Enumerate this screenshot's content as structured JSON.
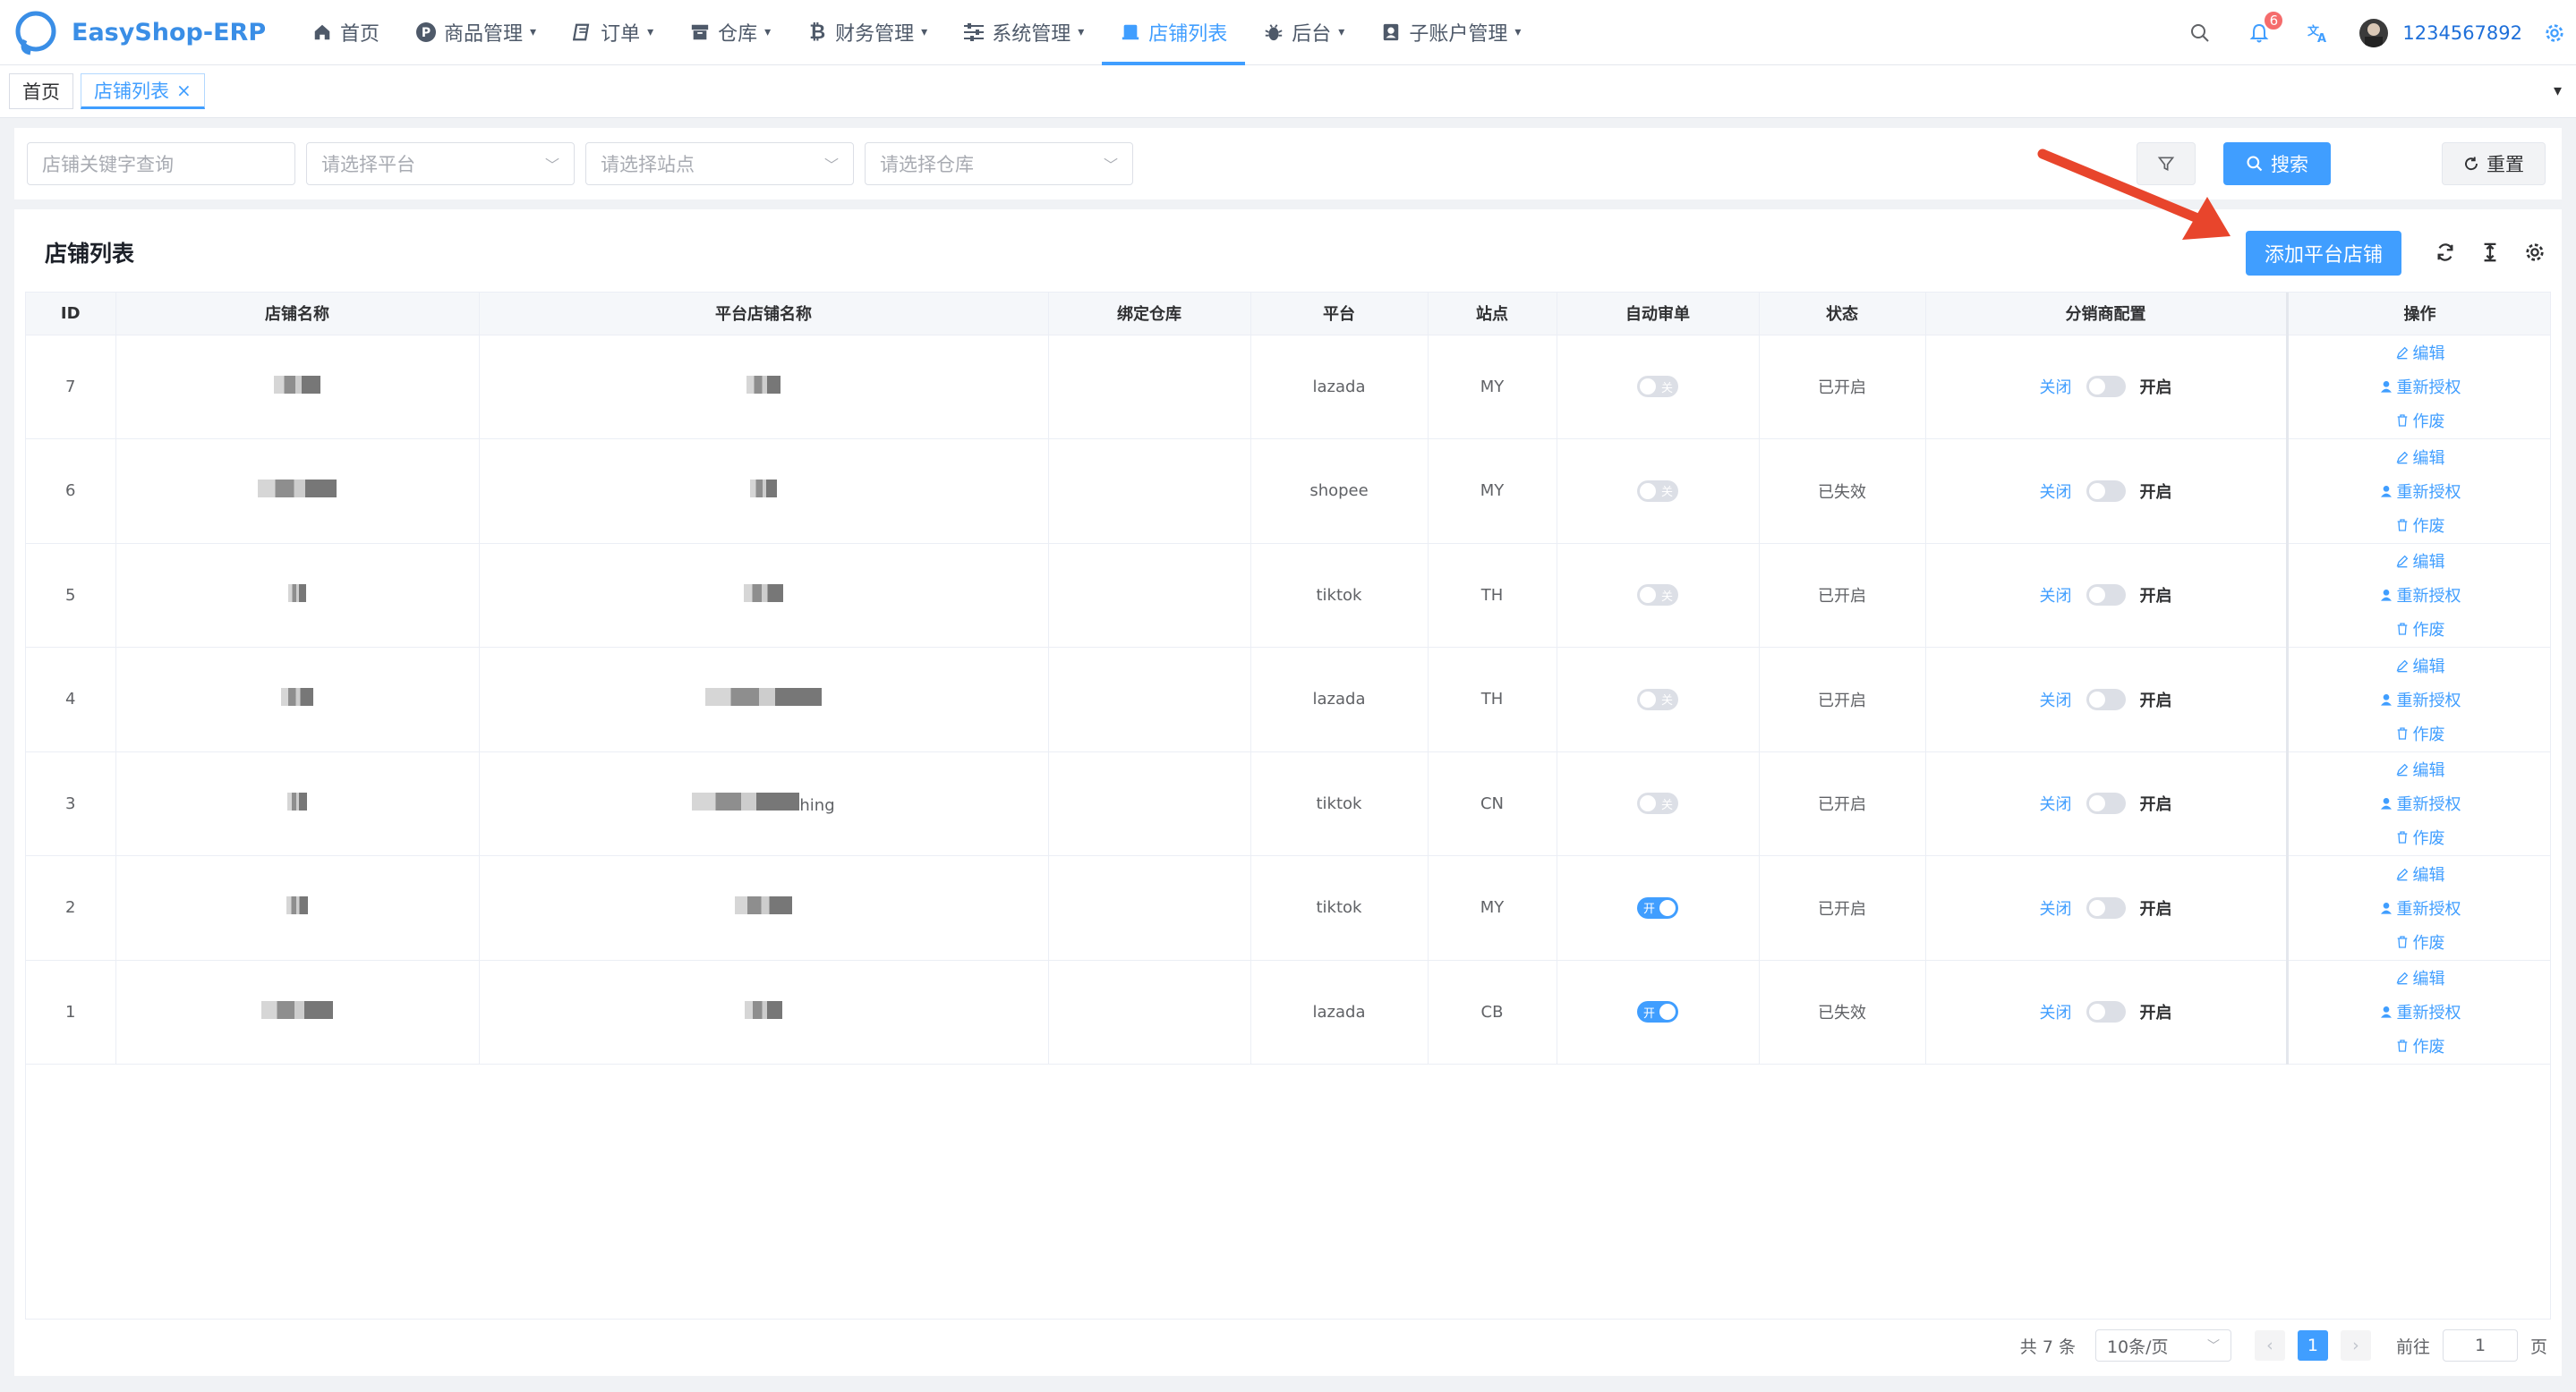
{
  "app": {
    "title": "EasyShop-ERP"
  },
  "nav": {
    "items": [
      {
        "label": "首页",
        "icon": "home-icon"
      },
      {
        "label": "商品管理",
        "icon": "product-icon"
      },
      {
        "label": "订单",
        "icon": "order-icon"
      },
      {
        "label": "仓库",
        "icon": "warehouse-icon"
      },
      {
        "label": "财务管理",
        "icon": "bitcoin-icon"
      },
      {
        "label": "系统管理",
        "icon": "sliders-icon"
      },
      {
        "label": "店铺列表",
        "icon": "store-icon",
        "active": true
      },
      {
        "label": "后台",
        "icon": "bug-icon"
      },
      {
        "label": "子账户管理",
        "icon": "user-card-icon"
      }
    ],
    "notification_count": "6",
    "username": "1234567892"
  },
  "tabs": [
    {
      "label": "首页"
    },
    {
      "label": "店铺列表",
      "active": true,
      "close": "×"
    }
  ],
  "filters": {
    "keyword_placeholder": "店铺关键字查询",
    "platform_placeholder": "请选择平台",
    "site_placeholder": "请选择站点",
    "warehouse_placeholder": "请选择仓库",
    "search_label": "搜索",
    "reset_label": "重置"
  },
  "main": {
    "title": "店铺列表",
    "add_button": "添加平台店铺"
  },
  "table": {
    "headers": [
      "ID",
      "店铺名称",
      "平台店铺名称",
      "绑定仓库",
      "平台",
      "站点",
      "自动审单",
      "状态",
      "分销商配置",
      "操作"
    ],
    "rows": [
      {
        "id": "7",
        "platform": "lazada",
        "site": "MY",
        "auto_review": "关",
        "auto_on": false,
        "status": "已开启"
      },
      {
        "id": "6",
        "platform": "shopee",
        "site": "MY",
        "auto_review": "关",
        "auto_on": false,
        "status": "已失效"
      },
      {
        "id": "5",
        "platform": "tiktok",
        "site": "TH",
        "auto_review": "关",
        "auto_on": false,
        "status": "已开启"
      },
      {
        "id": "4",
        "platform": "lazada",
        "site": "TH",
        "auto_review": "关",
        "auto_on": false,
        "status": "已开启"
      },
      {
        "id": "3",
        "platform": "tiktok",
        "site": "CN",
        "auto_review": "关",
        "auto_on": false,
        "status": "已开启",
        "platform_shop_text": "hing"
      },
      {
        "id": "2",
        "platform": "tiktok",
        "site": "MY",
        "auto_review": "开",
        "auto_on": true,
        "status": "已开启"
      },
      {
        "id": "1",
        "platform": "lazada",
        "site": "CB",
        "auto_review": "开",
        "auto_on": true,
        "status": "已失效"
      }
    ],
    "dist_off": "关闭",
    "dist_on": "开启",
    "op_edit": "编辑",
    "op_reauth": "重新授权",
    "op_void": "作废"
  },
  "pagination": {
    "total": "共 7 条",
    "page_size": "10条/页",
    "current": "1",
    "goto_label": "前往",
    "goto_value": "1",
    "page_suffix": "页"
  },
  "colors": {
    "accent": "#409eff",
    "annotation": "#e8452c"
  }
}
